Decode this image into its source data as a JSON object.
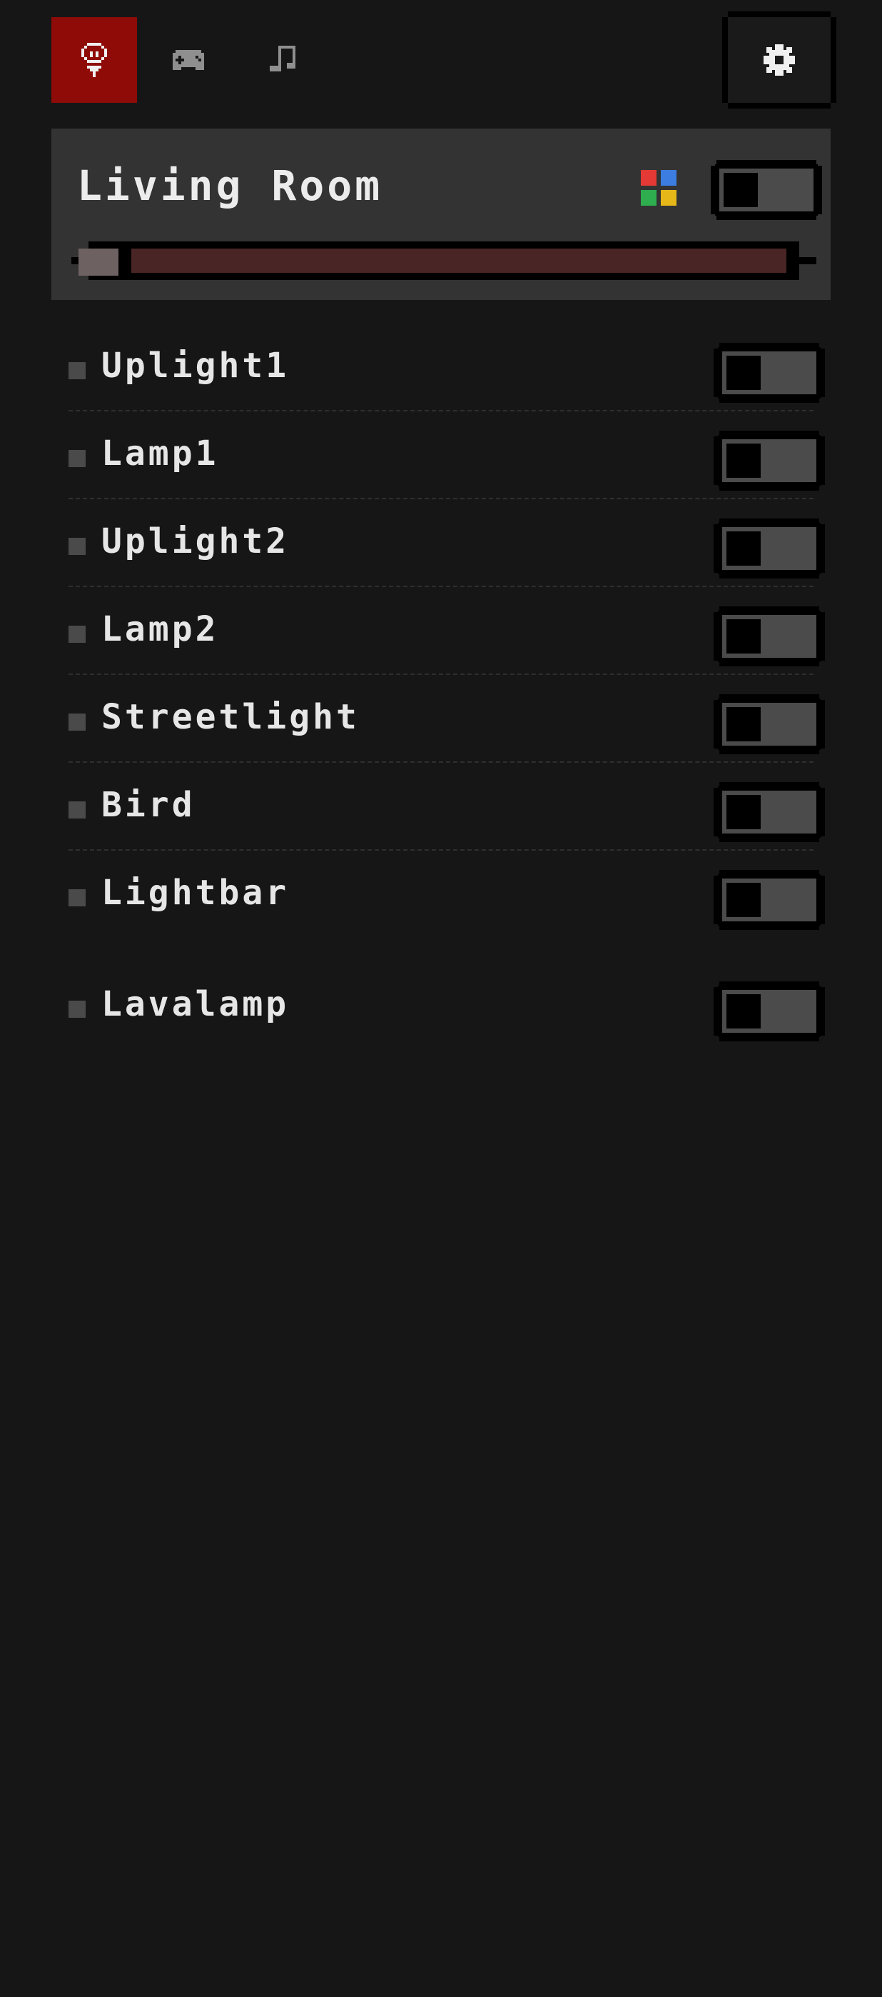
{
  "nav": {
    "tabs": [
      {
        "icon": "lightbulb-icon",
        "active": true
      },
      {
        "icon": "gamepad-icon",
        "active": false
      },
      {
        "icon": "music-note-icon",
        "active": false
      }
    ],
    "settings_icon": "gear-icon"
  },
  "room": {
    "name": "Living Room",
    "power_on": false,
    "palette_icon": "color-palette-icon",
    "brightness": 0.02
  },
  "devices": [
    {
      "name": "Uplight1",
      "on": false
    },
    {
      "name": "Lamp1",
      "on": false
    },
    {
      "name": "Uplight2",
      "on": false
    },
    {
      "name": "Lamp2",
      "on": false
    },
    {
      "name": "Streetlight",
      "on": false
    },
    {
      "name": "Bird",
      "on": false
    },
    {
      "name": "Lightbar",
      "on": false
    },
    {
      "name": "Lavalamp",
      "on": false
    }
  ],
  "colors": {
    "background": "#161616",
    "active_tab": "#8f0b07",
    "card": "#333333",
    "slider_track": "#4a2525",
    "palette": [
      "#e53935",
      "#3b7de0",
      "#2fae4f",
      "#e6b719"
    ]
  }
}
